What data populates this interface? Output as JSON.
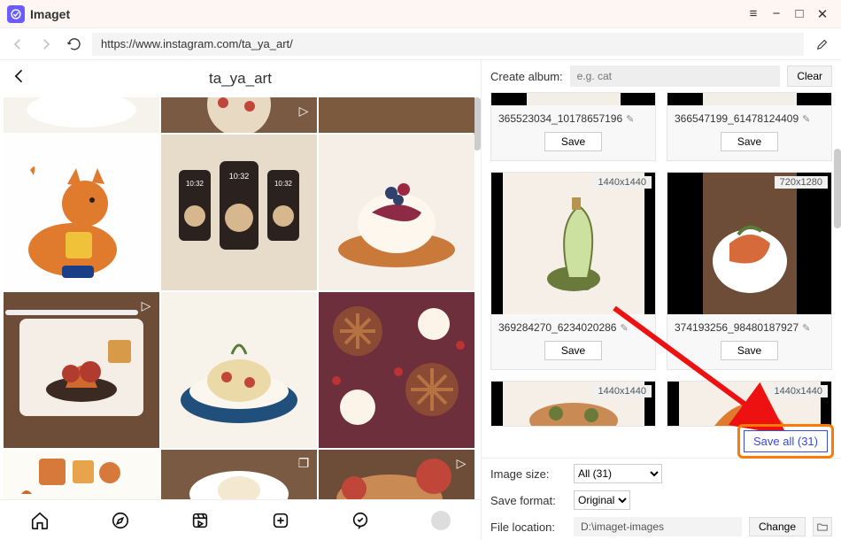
{
  "app": {
    "name": "Imaget"
  },
  "titlebar": {
    "menu_icon": "hamburger-icon",
    "min_icon": "minimize-icon",
    "max_icon": "maximize-icon",
    "close_icon": "close-icon"
  },
  "toolbar": {
    "url": "https://www.instagram.com/ta_ya_art/"
  },
  "left": {
    "profile_name": "ta_ya_art",
    "thumbs": [
      {
        "type": "half",
        "desc": "dessert-plate"
      },
      {
        "type": "half",
        "desc": "pasta-bowl",
        "reel": true
      },
      {
        "type": "half",
        "desc": "wooden-table"
      },
      {
        "type": "full",
        "desc": "fox-cartoon"
      },
      {
        "type": "full",
        "desc": "phones-food-app"
      },
      {
        "type": "full",
        "desc": "berry-dessert"
      },
      {
        "type": "full",
        "desc": "ipad-drawing",
        "reel": true
      },
      {
        "type": "full",
        "desc": "pasta-plate"
      },
      {
        "type": "full",
        "desc": "pies-pattern"
      },
      {
        "type": "partial",
        "desc": "autumn-stickers"
      },
      {
        "type": "partial",
        "desc": "cream-plate",
        "multi": true
      },
      {
        "type": "partial",
        "desc": "tomatoes-board",
        "reel": true
      }
    ]
  },
  "right": {
    "create_album_label": "Create album:",
    "album_placeholder": "e.g. cat",
    "clear_label": "Clear",
    "cards": [
      {
        "row": "top",
        "name": "365523034_10178657196",
        "save": "Save"
      },
      {
        "row": "top",
        "name": "366547199_61478124409",
        "save": "Save"
      },
      {
        "row": "mid",
        "name": "369284270_6234020286",
        "dims": "1440x1440",
        "save": "Save",
        "wide": true
      },
      {
        "row": "mid",
        "name": "374193256_98480187927",
        "dims": "720x1280",
        "save": "Save",
        "wide": false
      },
      {
        "row": "bot",
        "dims": "1440x1440"
      },
      {
        "row": "bot",
        "dims": "1440x1440"
      }
    ]
  },
  "controls": {
    "image_size_label": "Image size:",
    "image_size_value": "All (31)",
    "save_all_label": "Save all (31)",
    "save_format_label": "Save format:",
    "save_format_value": "Original",
    "file_location_label": "File location:",
    "file_location_value": "D:\\imaget-images",
    "change_label": "Change"
  }
}
